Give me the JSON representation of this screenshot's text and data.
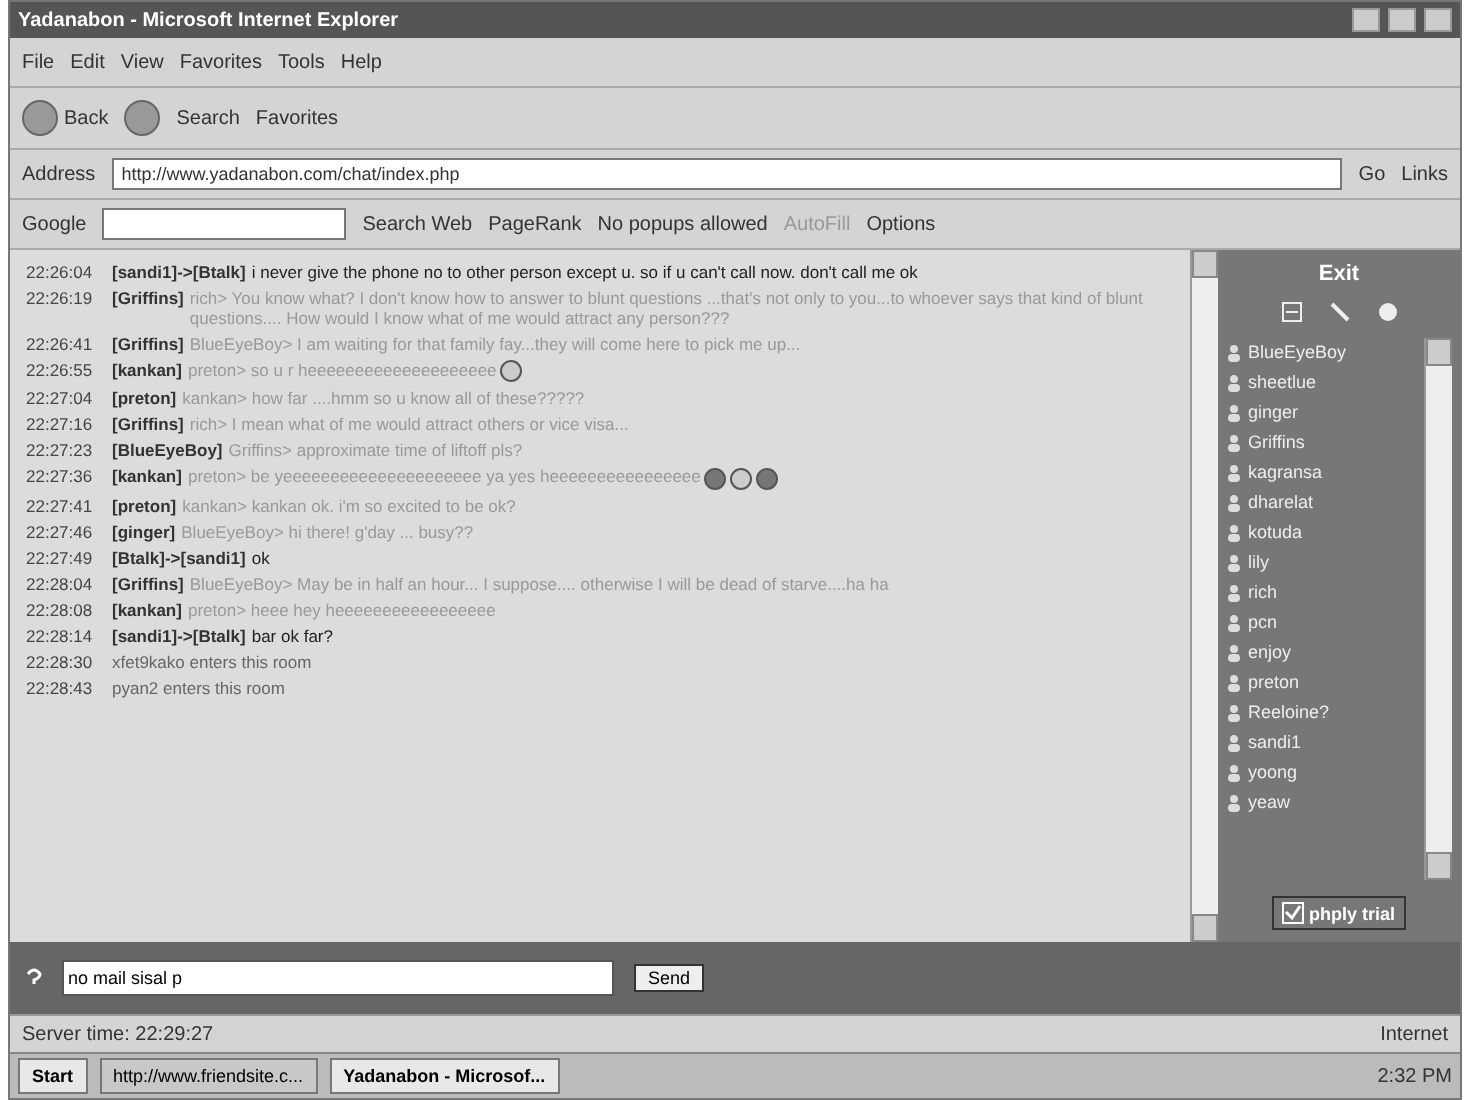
{
  "window": {
    "title": "Yadanabon - Microsoft Internet Explorer"
  },
  "menu": [
    "File",
    "Edit",
    "View",
    "Favorites",
    "Tools",
    "Help"
  ],
  "toolbar": {
    "back": "Back",
    "search": "Search",
    "favorites": "Favorites"
  },
  "address": {
    "label": "Address",
    "value": "http://www.yadanabon.com/chat/index.php",
    "go": "Go",
    "links": "Links"
  },
  "google_bar": {
    "logo": "Google",
    "search_web": "Search Web",
    "pagerank": "PageRank",
    "popups": "No popups allowed",
    "autofill": "AutoFill",
    "options": "Options"
  },
  "messages": [
    {
      "time": "22:26:04",
      "sender": "[sandi1]->[Btalk]",
      "text": "i never give the phone no to other person except u. so if u can't call now. don't call me ok",
      "kind": "private"
    },
    {
      "time": "22:26:19",
      "sender": "[Griffins]",
      "text": "rich> You know what? I don't know how to answer to blunt questions ...that's not only to you...to whoever says that kind of blunt questions.... How would I know what of me would attract any person???",
      "kind": "public"
    },
    {
      "time": "22:26:41",
      "sender": "[Griffins]",
      "text": "BlueEyeBoy> I am waiting for that family fay...they will come here to pick me up...",
      "kind": "public"
    },
    {
      "time": "22:26:55",
      "sender": "[kankan]",
      "text": "preton> so u r heeeeeeeeeeeeeeeeeeee",
      "kind": "public",
      "icons": [
        {
          "kind": "smiley"
        }
      ]
    },
    {
      "time": "22:27:04",
      "sender": "[preton]",
      "text": "kankan> how far ....hmm so u know all of these?????",
      "kind": "public"
    },
    {
      "time": "22:27:16",
      "sender": "[Griffins]",
      "text": "rich> I mean what of me would attract others or vice visa...",
      "kind": "public"
    },
    {
      "time": "22:27:23",
      "sender": "[BlueEyeBoy]",
      "text": "Griffins> approximate time of liftoff pls?",
      "kind": "public"
    },
    {
      "time": "22:27:36",
      "sender": "[kankan]",
      "text": "preton> be yeeeeeeeeeeeeeeeeeeeee ya yes heeeeeeeeeeeeeeee",
      "kind": "public",
      "icons": [
        {
          "kind": "dot"
        },
        {
          "kind": "smiley"
        },
        {
          "kind": "dot"
        }
      ]
    },
    {
      "time": "22:27:41",
      "sender": "[preton]",
      "text": "kankan> kankan ok. i'm so excited to be ok?",
      "kind": "public"
    },
    {
      "time": "22:27:46",
      "sender": "[ginger]",
      "text": "BlueEyeBoy> hi there! g'day ... busy??",
      "kind": "public"
    },
    {
      "time": "22:27:49",
      "sender": "[Btalk]->[sandi1]",
      "text": "ok",
      "kind": "private"
    },
    {
      "time": "22:28:04",
      "sender": "[Griffins]",
      "text": "BlueEyeBoy> May be in half an hour... I suppose.... otherwise I will be dead of starve....ha ha",
      "kind": "public"
    },
    {
      "time": "22:28:08",
      "sender": "[kankan]",
      "text": "preton> heee hey heeeeeeeeeeeeeeeee",
      "kind": "public"
    },
    {
      "time": "22:28:14",
      "sender": "[sandi1]->[Btalk]",
      "text": "bar ok far?",
      "kind": "private"
    },
    {
      "time": "22:28:30",
      "text": "xfet9kako enters this room",
      "kind": "system"
    },
    {
      "time": "22:28:43",
      "text": "pyan2 enters this room",
      "kind": "system"
    }
  ],
  "panel": {
    "exit": "Exit",
    "users": [
      "BlueEyeBoy",
      "sheetlue",
      "ginger",
      "Griffins",
      "kagransa",
      "dharelat",
      "kotuda",
      "lily",
      "rich",
      "pcn",
      "enjoy",
      "preton",
      "Reeloine?",
      "sandi1",
      "yoong",
      "yeaw"
    ],
    "trial": "phply trial",
    "trial_checked": true
  },
  "input": {
    "value": "no mail sisal p",
    "send": "Send"
  },
  "status_bar": {
    "text": "Server time: 22:29:27",
    "zone": "Internet"
  },
  "taskbar": {
    "start": "Start",
    "tasks": [
      {
        "label": "http://www.friendsite.c...",
        "selected": false
      },
      {
        "label": "Yadanabon - Microsof...",
        "selected": true
      }
    ],
    "clock": "2:32 PM"
  }
}
